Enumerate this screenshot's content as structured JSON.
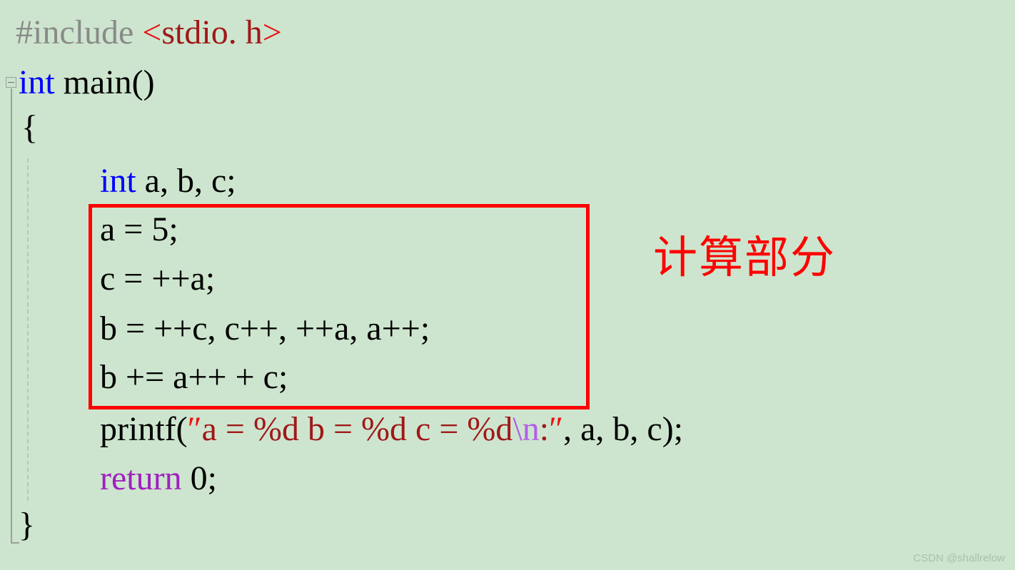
{
  "editor": {
    "background_color": "#cde5ce",
    "gutter": {
      "fold_marker_label": "-",
      "fold_marker_name": "collapse-fold-icon"
    },
    "colors": {
      "preprocessor": "#8a8a8a",
      "header_name": "#a01818",
      "angle_bracket": "#e81010",
      "keyword": "#0000ff",
      "plain_text": "#000000",
      "return_keyword": "#a020c0",
      "string": "#a01818",
      "string_quote": "#f01010",
      "escape_sequence": "#b45ce8",
      "highlight_rect": "#ff0000",
      "annotation": "#ff0000",
      "watermark": "#a8bfa9"
    }
  },
  "code": {
    "line_include": {
      "preproc": "#include ",
      "open_angle": "<",
      "header": "stdio. h",
      "close_angle": ">"
    },
    "line_main": {
      "keyword": "int",
      "rest": " main()"
    },
    "line_open_brace": "{",
    "line_declaration": {
      "keyword": "int",
      "rest": " a, b, c;"
    },
    "line_assign_a": "a = 5;",
    "line_assign_c": "c = ++a;",
    "line_assign_b_multi": "b = ++c, c++, ++a, a++;",
    "line_assign_b_plus": "b += a++ + c;",
    "line_printf": {
      "fn": "printf(",
      "open_quote": "″",
      "str_part1": "a = %d b = %d c = %d",
      "escape": "\\n",
      "str_part2": ":",
      "close_quote": "″",
      "args": ", a, b, c);"
    },
    "line_return": {
      "keyword": "return",
      "rest": " 0;"
    },
    "line_close_brace": "}"
  },
  "annotation": {
    "text": "计算部分"
  },
  "watermark": {
    "text": "CSDN @shallrelow"
  }
}
